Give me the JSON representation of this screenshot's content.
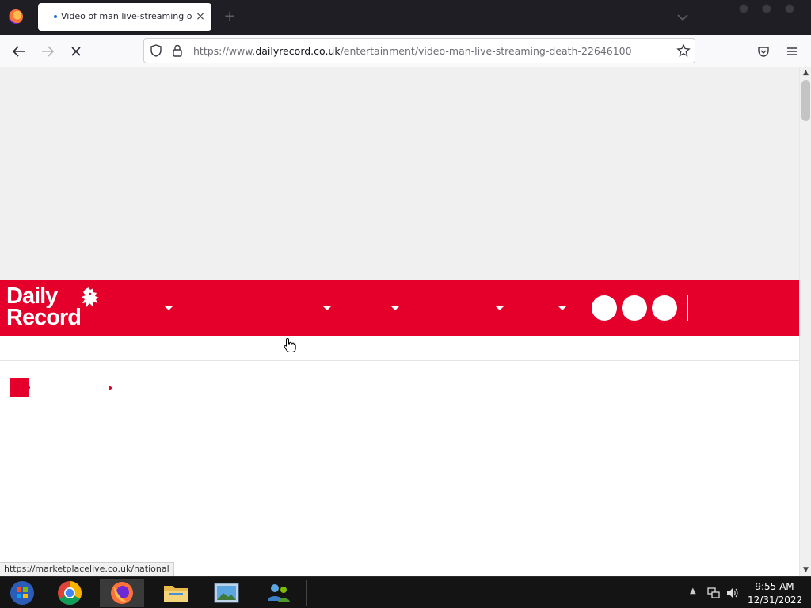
{
  "browser": {
    "tab": {
      "title": "Video of man live-streaming own",
      "close_glyph": "×"
    },
    "new_tab_glyph": "+",
    "url": {
      "prefix": "https://www.",
      "domain": "dailyrecord.co.uk",
      "path": "/entertainment/video-man-live-streaming-death-22646100"
    },
    "status_link": "https://marketplacelive.co.uk/national",
    "icons": {
      "back": "arrow-left-icon",
      "forward": "arrow-right-icon",
      "stop": "close-icon",
      "shield": "shield-icon",
      "lock": "lock-icon",
      "bookmark": "star-icon",
      "pocket": "pocket-icon",
      "menu": "hamburger-menu-icon"
    }
  },
  "site": {
    "logo": {
      "line1": "Daily",
      "line2": "Record"
    },
    "brand_color": "#e5002b",
    "nav_dropdowns": 5,
    "social_buttons": 3
  },
  "taskbar": {
    "apps": [
      "start-orb-icon",
      "chrome-icon",
      "firefox-icon",
      "file-explorer-icon",
      "photo-viewer-icon",
      "network-people-icon"
    ],
    "clock": {
      "time": "9:55 AM",
      "date": "12/31/2022"
    },
    "scroll_up_glyph": "▲",
    "scroll_down_glyph": "▼",
    "tray_up_glyph": "▲"
  }
}
